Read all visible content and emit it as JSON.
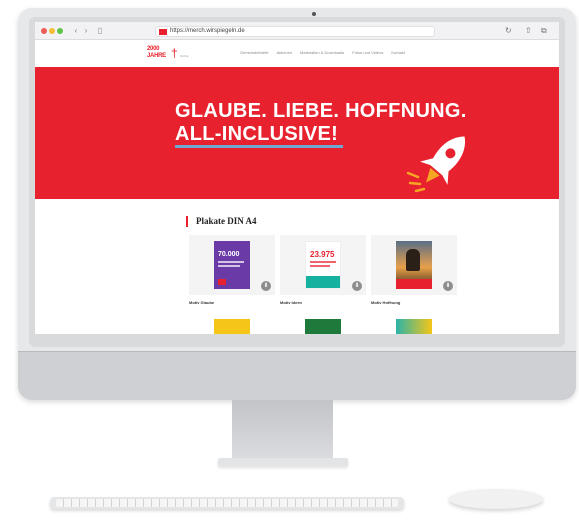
{
  "browser": {
    "url": "https://merch.wirspiegeln.de",
    "nav_back": "‹",
    "nav_forward": "›",
    "sidebar_icon": "▯",
    "share_icon": "⇧",
    "tabs_icon": "⧉",
    "reload_icon": "↻"
  },
  "site": {
    "logo_line1": "2000",
    "logo_line2": "JAHRE",
    "logo_text": "Kirche",
    "nav": [
      "Gemeindebriefe",
      "Aktionen",
      "Materialien & Downloads",
      "Fotos und Videos",
      "Kontakt"
    ]
  },
  "hero": {
    "line1": "GLAUBE. LIEBE. HOFFNUNG.",
    "line2": "ALL-INCLUSIVE!"
  },
  "section": {
    "title": "Plakate DIN A4"
  },
  "posters": [
    {
      "label": "Motiv Glaube",
      "img_headline": "70.000",
      "bg": "#6a3aa6",
      "badge": "⬇"
    },
    {
      "label": "Motiv Ideen",
      "img_headline": "23.975",
      "bg": "#ffffff",
      "badge": "⬇"
    },
    {
      "label": "Motiv Hoffnung",
      "img_headline": "",
      "bg": "#3a3a3a",
      "badge": "⬇"
    }
  ],
  "colors": {
    "brand_red": "#e8212e",
    "accent_blue": "#6fa8d0"
  }
}
